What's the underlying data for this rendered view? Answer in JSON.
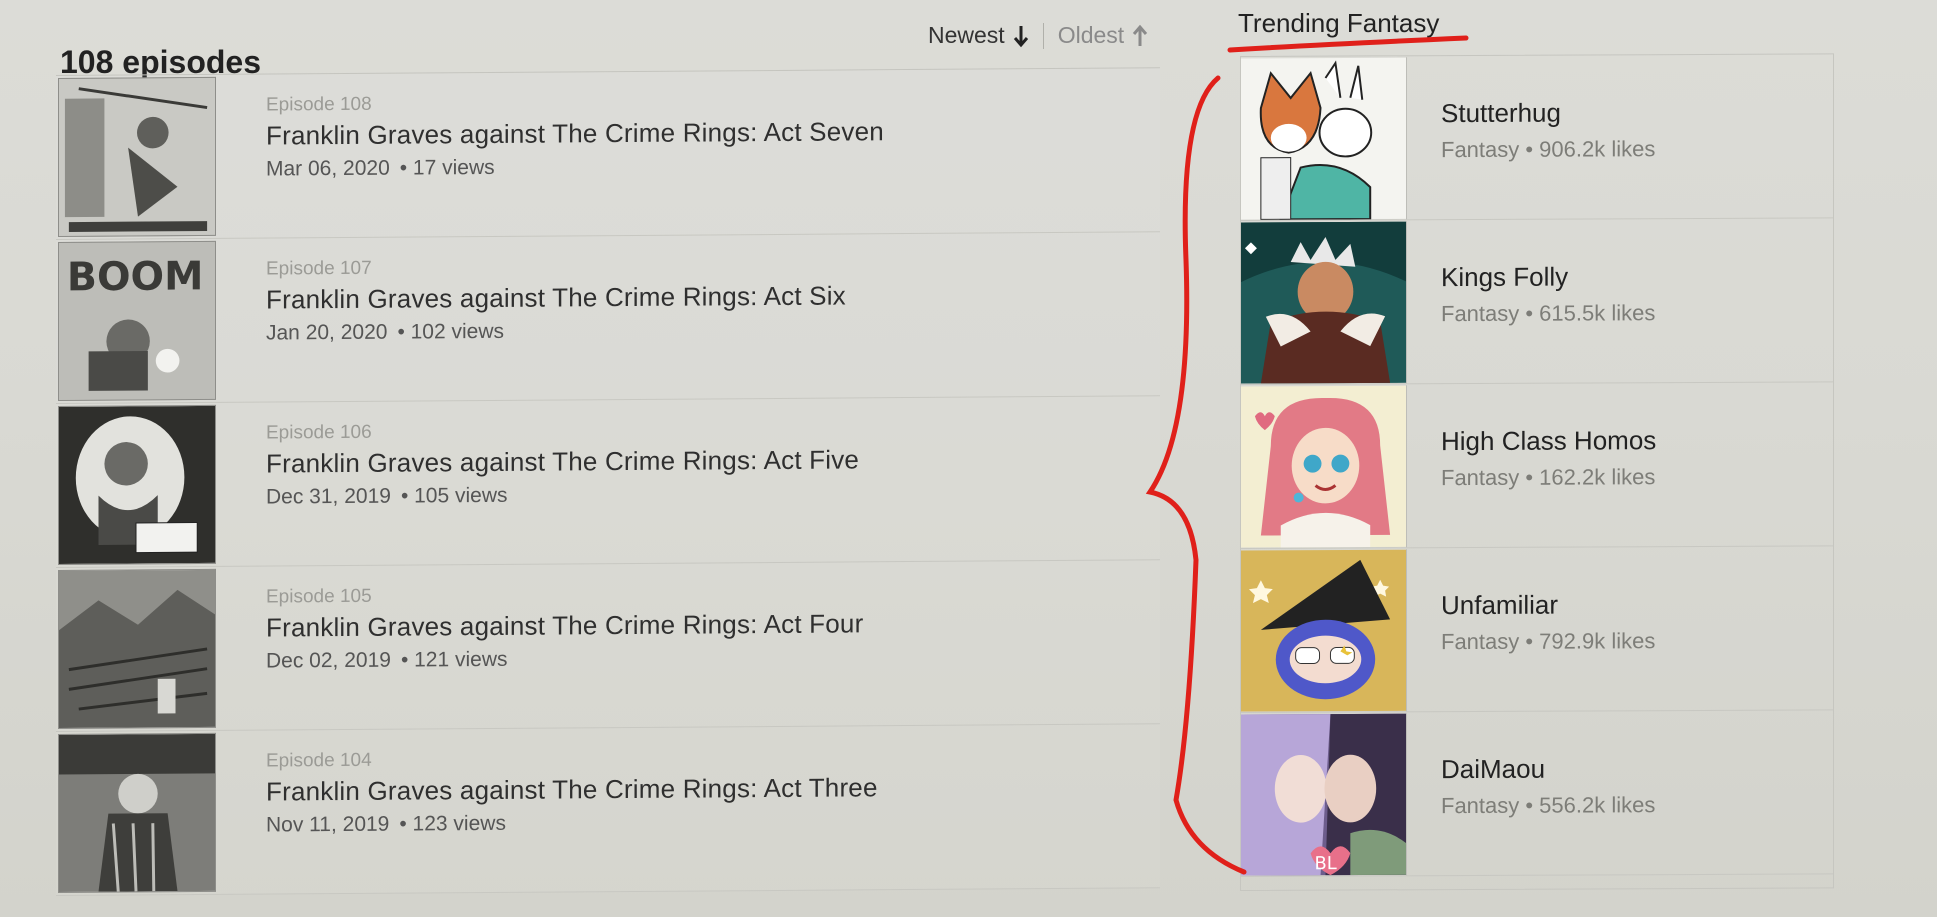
{
  "episodes": {
    "count_label": "108 episodes",
    "sort": {
      "newest": "Newest",
      "oldest": "Oldest"
    },
    "items": [
      {
        "number": "Episode 108",
        "title": "Franklin Graves against The Crime Rings: Act Seven",
        "date": "Mar 06, 2020",
        "views": "• 17 views"
      },
      {
        "number": "Episode 107",
        "title": "Franklin Graves against The Crime Rings: Act Six",
        "date": "Jan 20, 2020",
        "views": "• 102 views"
      },
      {
        "number": "Episode 106",
        "title": "Franklin Graves against The Crime Rings: Act Five",
        "date": "Dec 31, 2019",
        "views": "• 105 views"
      },
      {
        "number": "Episode 105",
        "title": "Franklin Graves against The Crime Rings: Act Four",
        "date": "Dec 02, 2019",
        "views": "• 121 views"
      },
      {
        "number": "Episode 104",
        "title": "Franklin Graves against The Crime Rings: Act Three",
        "date": "Nov 11, 2019",
        "views": "• 123 views"
      }
    ]
  },
  "trending": {
    "title": "Trending Fantasy",
    "items": [
      {
        "name": "Stutterhug",
        "meta": "Fantasy • 906.2k likes"
      },
      {
        "name": "Kings Folly",
        "meta": "Fantasy • 615.5k likes"
      },
      {
        "name": "High Class Homos",
        "meta": "Fantasy • 162.2k likes"
      },
      {
        "name": "Unfamiliar",
        "meta": "Fantasy • 792.9k likes"
      },
      {
        "name": "DaiMaou",
        "meta": "Fantasy • 556.2k likes",
        "badge": "BL"
      }
    ]
  },
  "annotation_color": "#e0201a"
}
